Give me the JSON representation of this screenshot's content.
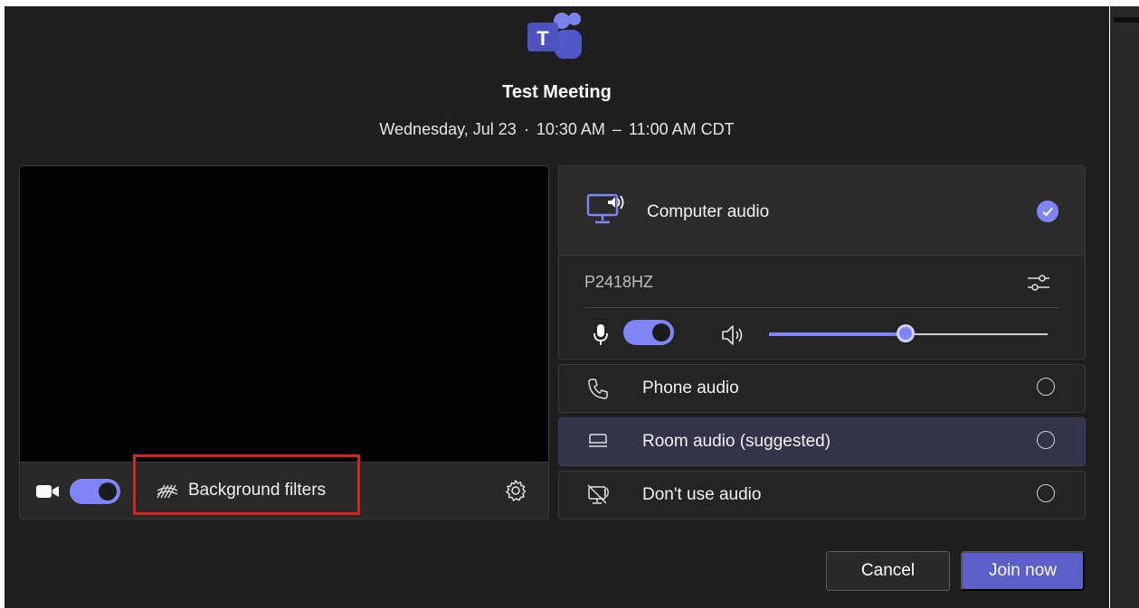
{
  "meeting": {
    "title": "Test Meeting",
    "date": "Wednesday, Jul 23",
    "start": "10:30 AM",
    "end": "11:00 AM CDT"
  },
  "video": {
    "camera_on": true,
    "background_filters_label": "Background filters"
  },
  "audio": {
    "computer_audio_label": "Computer audio",
    "computer_audio_selected": true,
    "device": "P2418HZ",
    "mic_on": true,
    "volume_percent": 49,
    "options": [
      {
        "label": "Phone audio",
        "icon": "phone-icon",
        "suggested": false
      },
      {
        "label": "Room audio (suggested)",
        "icon": "room-audio-icon",
        "suggested": true
      },
      {
        "label": "Don't use audio",
        "icon": "no-audio-icon",
        "suggested": false
      }
    ]
  },
  "actions": {
    "cancel_label": "Cancel",
    "join_label": "Join now"
  },
  "colors": {
    "accent": "#7f85f5",
    "primary_button": "#5b5fc7",
    "highlight": "#d92121",
    "background": "#1f1f1f"
  }
}
